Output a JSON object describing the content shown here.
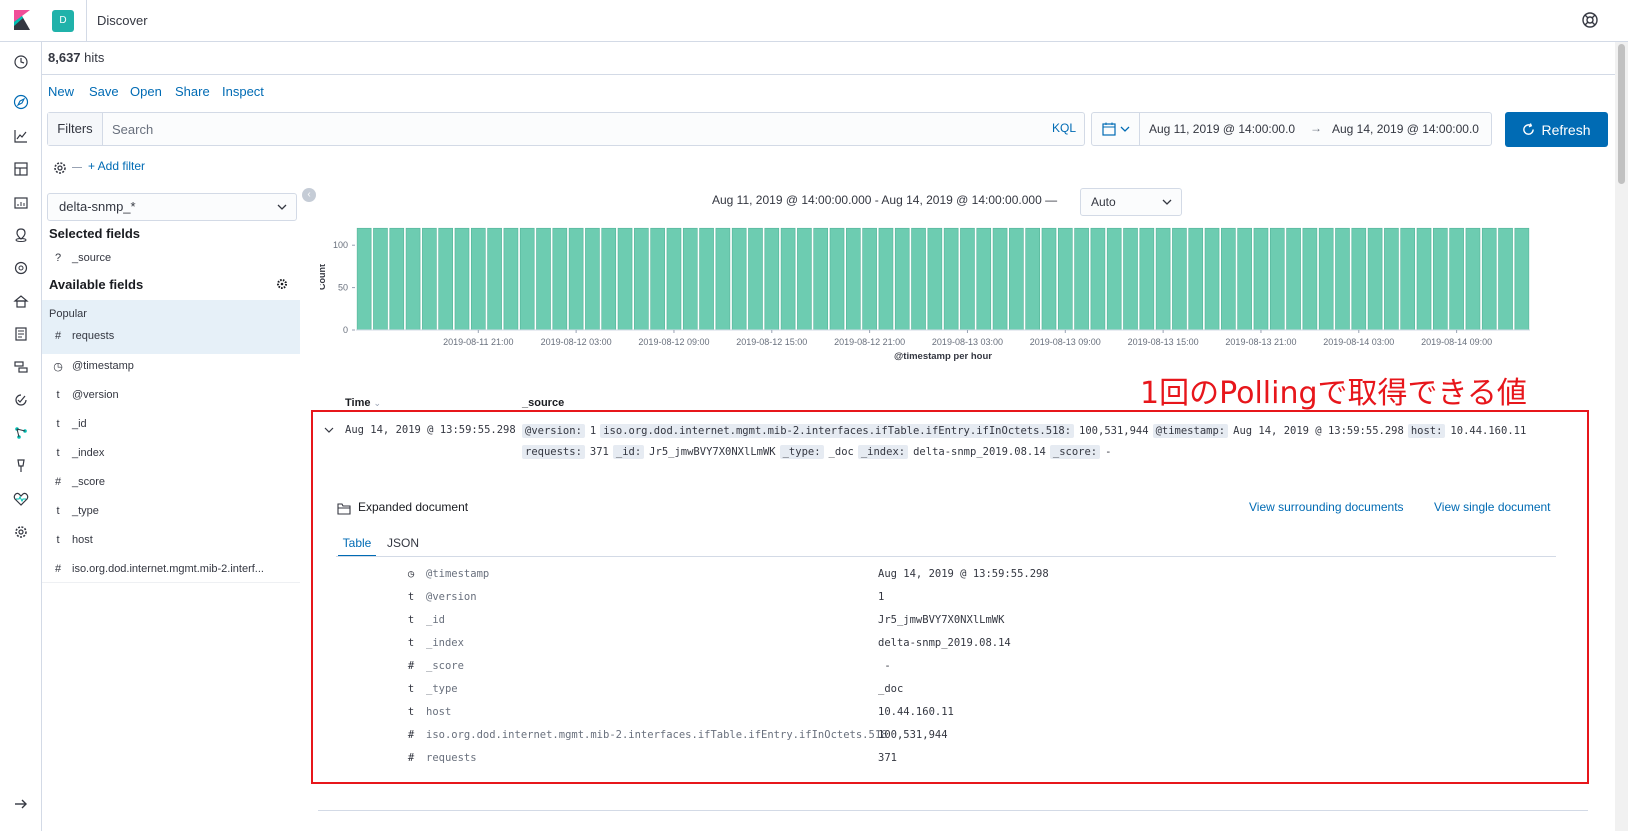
{
  "header": {
    "space_initial": "D",
    "app_title": "Discover"
  },
  "hits": {
    "count": "8,637",
    "label": "hits"
  },
  "top_menu": {
    "new": "New",
    "save": "Save",
    "open": "Open",
    "share": "Share",
    "inspect": "Inspect"
  },
  "query": {
    "filters_label": "Filters",
    "search_placeholder": "Search",
    "language": "KQL",
    "add_filter": "+ Add filter"
  },
  "time": {
    "start": "Aug 11, 2019 @ 14:00:00.0",
    "arrow": "→",
    "end": "Aug 14, 2019 @ 14:00:00.0",
    "refresh_label": "Refresh"
  },
  "sidebar": {
    "index_pattern": "delta-snmp_*",
    "selected_heading": "Selected fields",
    "selected": [
      {
        "type": "?",
        "name": "_source"
      }
    ],
    "available_heading": "Available fields",
    "popular_label": "Popular",
    "popular": [
      {
        "type": "#",
        "name": "requests"
      }
    ],
    "fields": [
      {
        "type": "◷",
        "name": "@timestamp"
      },
      {
        "type": "t",
        "name": "@version"
      },
      {
        "type": "t",
        "name": "_id"
      },
      {
        "type": "t",
        "name": "_index"
      },
      {
        "type": "#",
        "name": "_score"
      },
      {
        "type": "t",
        "name": "_type"
      },
      {
        "type": "t",
        "name": "host"
      },
      {
        "type": "#",
        "name": "iso.org.dod.internet.mgmt.mib-2.interf..."
      }
    ]
  },
  "histogram": {
    "range_label": "Aug 11, 2019 @ 14:00:00.000 - Aug 14, 2019 @ 14:00:00.000 —",
    "interval": "Auto"
  },
  "chart_data": {
    "type": "bar",
    "xlabel": "@timestamp per hour",
    "ylabel": "Count",
    "ylim": [
      0,
      125
    ],
    "yticks": [
      0,
      50,
      100
    ],
    "bar_count": 72,
    "bar_value": 120,
    "xticks": [
      "2019-08-11 21:00",
      "2019-08-12 03:00",
      "2019-08-12 09:00",
      "2019-08-12 15:00",
      "2019-08-12 21:00",
      "2019-08-13 03:00",
      "2019-08-13 09:00",
      "2019-08-13 15:00",
      "2019-08-13 21:00",
      "2019-08-14 03:00",
      "2019-08-14 09:00"
    ],
    "xtick_bar_index": [
      7,
      13,
      19,
      25,
      31,
      37,
      43,
      49,
      55,
      61,
      67
    ],
    "bar_color": "#6dccb1"
  },
  "table": {
    "col_time": "Time",
    "col_source": "_source",
    "row_time": "Aug 14, 2019 @ 13:59:55.298",
    "source_line1": [
      {
        "k": "@version:",
        "v": "1"
      },
      {
        "k": "iso.org.dod.internet.mgmt.mib-2.interfaces.ifTable.ifEntry.ifInOctets.518:",
        "v": "100,531,944"
      },
      {
        "k": "@timestamp:",
        "v": "Aug 14, 2019 @ 13:59:55.298"
      },
      {
        "k": "host:",
        "v": "10.44.160.11"
      }
    ],
    "source_line2": [
      {
        "k": "requests:",
        "v": "371"
      },
      {
        "k": "_id:",
        "v": "Jr5_jmwBVY7X0NXlLmWK"
      },
      {
        "k": "_type:",
        "v": "_doc"
      },
      {
        "k": "_index:",
        "v": "delta-snmp_2019.08.14"
      },
      {
        "k": "_score:",
        "v": "-"
      }
    ]
  },
  "annotation": "1回のPollingで取得できる値",
  "expanded": {
    "title": "Expanded document",
    "view_surrounding": "View surrounding documents",
    "view_single": "View single document",
    "tab_table": "Table",
    "tab_json": "JSON",
    "rows": [
      {
        "type": "◷",
        "key": "@timestamp",
        "value": "Aug 14, 2019 @ 13:59:55.298"
      },
      {
        "type": "t",
        "key": "@version",
        "value": "1"
      },
      {
        "type": "t",
        "key": "_id",
        "value": "Jr5_jmwBVY7X0NXlLmWK"
      },
      {
        "type": "t",
        "key": "_index",
        "value": "delta-snmp_2019.08.14"
      },
      {
        "type": "#",
        "key": "_score",
        "value": " -"
      },
      {
        "type": "t",
        "key": "_type",
        "value": "_doc"
      },
      {
        "type": "t",
        "key": "host",
        "value": "10.44.160.11"
      },
      {
        "type": "#",
        "key": "iso.org.dod.internet.mgmt.mib-2.interfaces.ifTable.ifEntry.ifInOctets.518",
        "value": "100,531,944"
      },
      {
        "type": "#",
        "key": "requests",
        "value": "371"
      }
    ]
  },
  "colors": {
    "accent": "#006bb4",
    "annotation": "#e7161b",
    "bar": "#6dccb1"
  }
}
